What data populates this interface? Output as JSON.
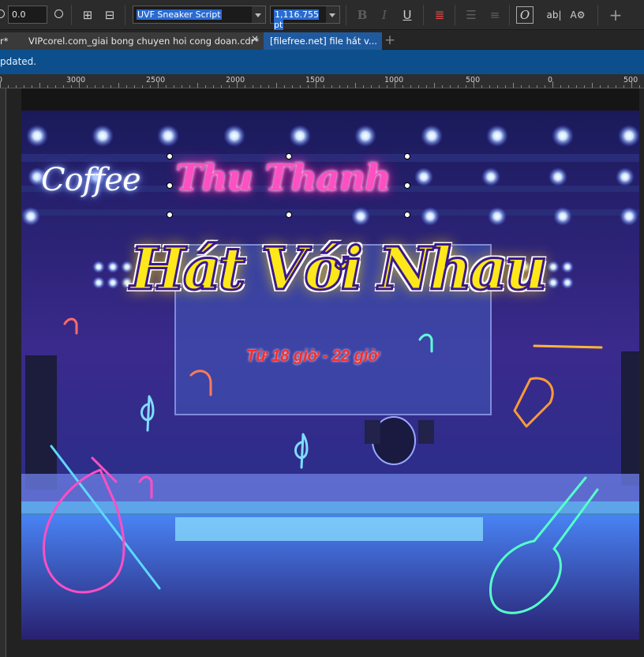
{
  "toolbar": {
    "outline_width": "0.0",
    "font_name": "UVF Sneaker Script",
    "font_size": "1,116.755 pt",
    "bold_icon": "bold-icon",
    "italic_icon": "italic-icon",
    "underline_icon": "underline-icon",
    "opentype_icon": "opentype-icon",
    "add_icon": "+"
  },
  "tabs": [
    {
      "label": "r*"
    },
    {
      "label": "VIPcorel.com_giai bong chuyen hoi cong doan.cdr*",
      "close": "×"
    },
    {
      "label": "[filefree.net] file hát v..."
    }
  ],
  "notice": {
    "text": "pdated."
  },
  "ruler": {
    "labels": [
      "0",
      "3000",
      "2500",
      "2000",
      "1500",
      "1000",
      "500",
      "0",
      "500"
    ]
  },
  "artwork": {
    "coffee": "Coffee",
    "venue": "Thu Thanh",
    "headline": "Hát Với Nhau",
    "time": "Từ 18 giờ - 22 giờ"
  },
  "colors": {
    "accent_blue": "#1f5a9e",
    "notice_blue": "#0c4f8c",
    "neon_pink": "#ff4fc3",
    "neon_yellow": "#ffe81a",
    "time_red": "#ff2a2a"
  }
}
